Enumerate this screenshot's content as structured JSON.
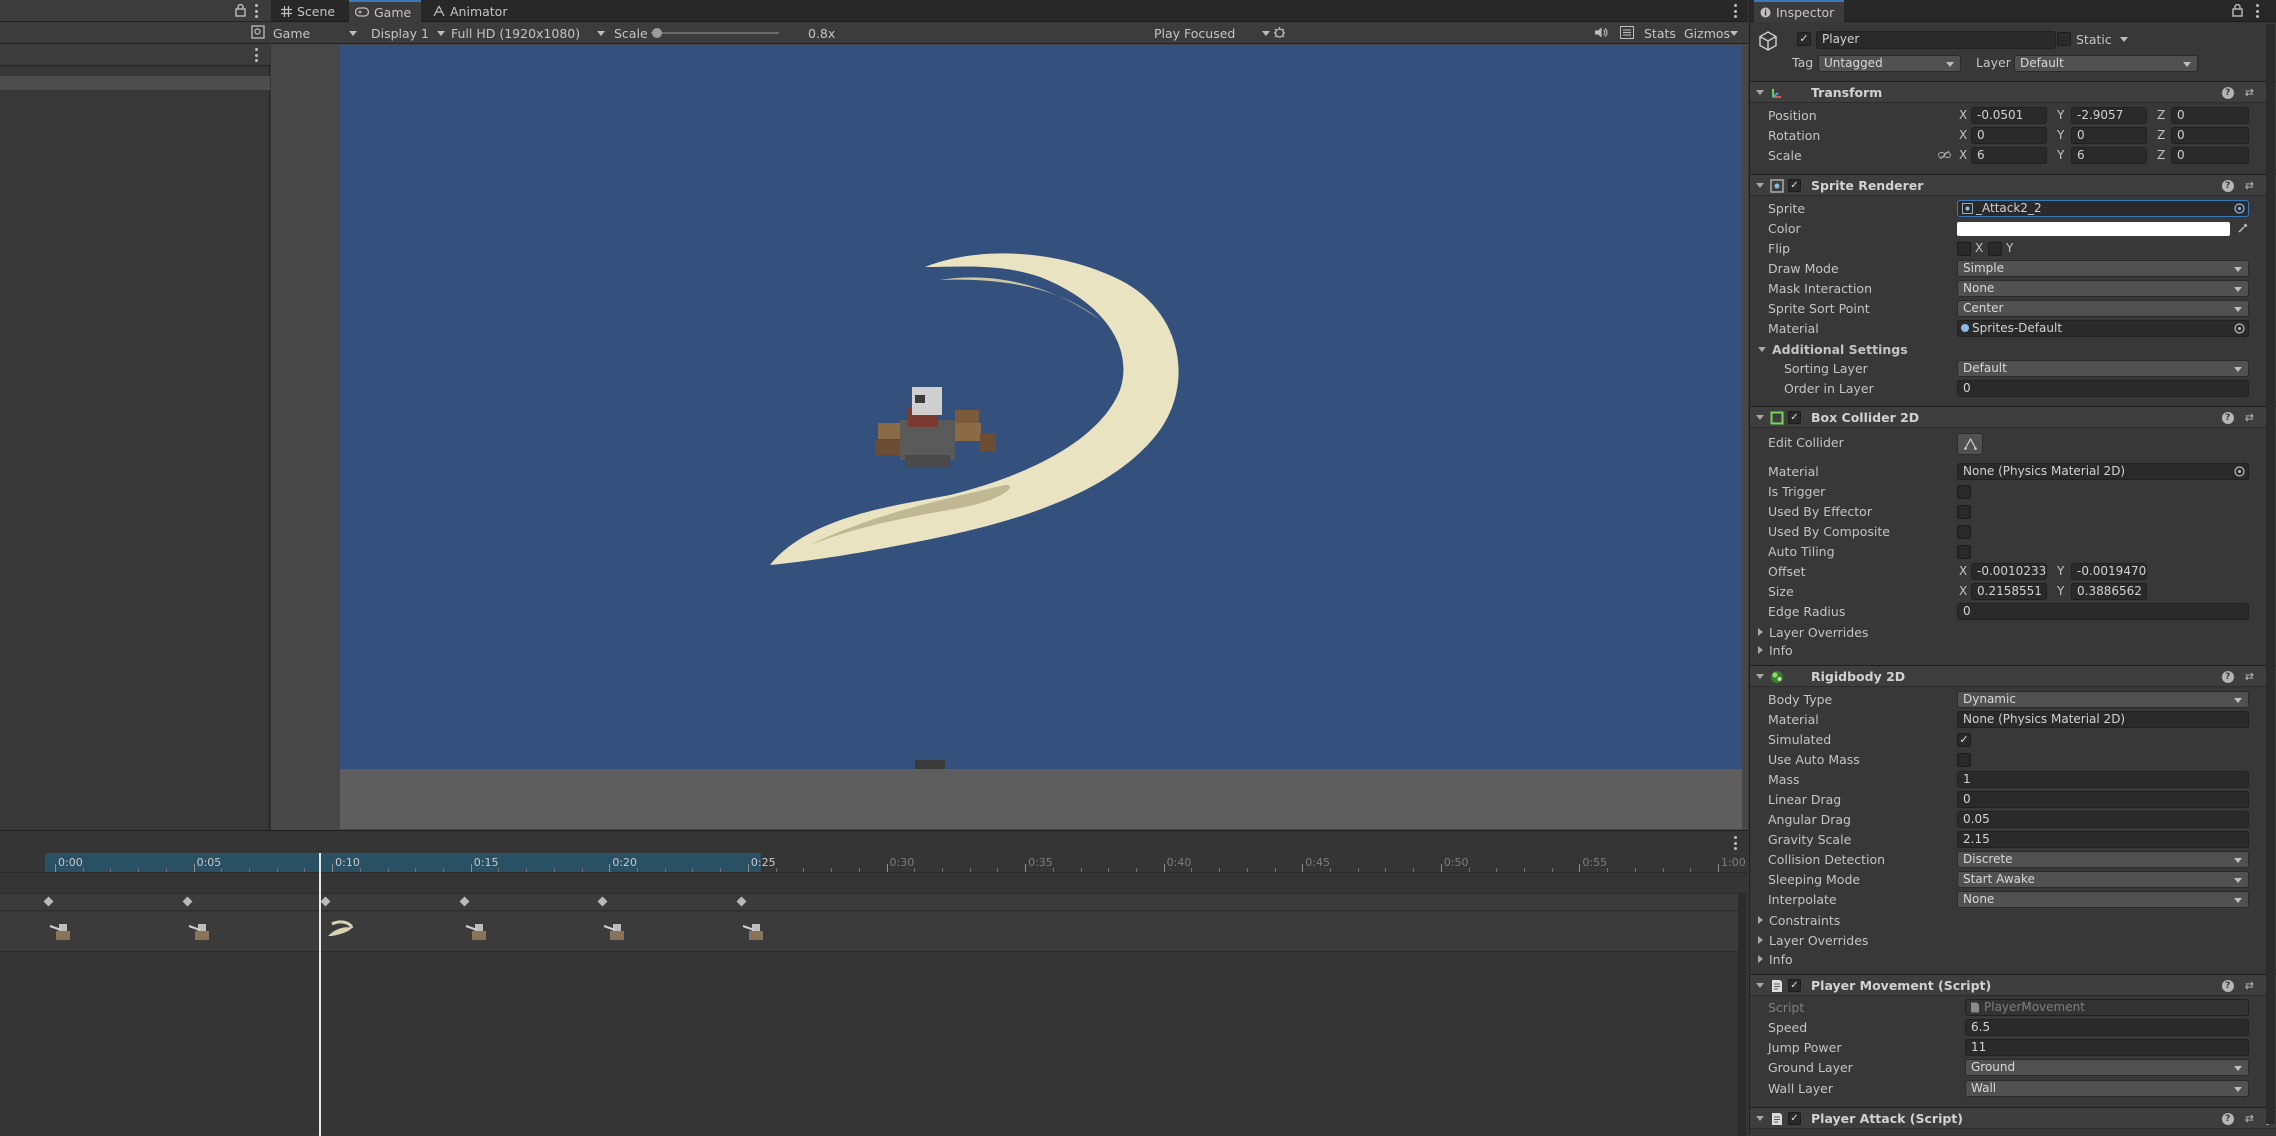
{
  "game_tabs": [
    {
      "label": "Scene",
      "icon": "grid-icon"
    },
    {
      "label": "Game",
      "icon": "gamepad-icon",
      "active": true
    },
    {
      "label": "Animator",
      "icon": "animator-icon"
    }
  ],
  "game_toolbar": {
    "mode": "Game",
    "display": "Display 1",
    "resolution": "Full HD (1920x1080)",
    "scale_label": "Scale",
    "scale_value": "0.8x",
    "scale_fraction": 0.05,
    "play_mode": "Play Focused",
    "stats": "Stats",
    "gizmos": "Gizmos"
  },
  "colors": {
    "sky": "#34507c",
    "ground": "#5e5e5e",
    "accent": "#3a79bb",
    "timeline_highlight": "#2a5064"
  },
  "inspector": {
    "tab": "Inspector",
    "object_name": "Player",
    "static_label": "Static",
    "tag_label": "Tag",
    "tag_value": "Untagged",
    "layer_label": "Layer",
    "layer_value": "Default",
    "transform": {
      "title": "Transform",
      "position_label": "Position",
      "rotation_label": "Rotation",
      "scale_label": "Scale",
      "position": {
        "x": "-0.0501",
        "y": "-2.9057",
        "z": "0"
      },
      "rotation": {
        "x": "0",
        "y": "0",
        "z": "0"
      },
      "scale": {
        "x": "6",
        "y": "6",
        "z": "0"
      }
    },
    "sprite_renderer": {
      "title": "Sprite Renderer",
      "rows": [
        {
          "label": "Sprite",
          "value": "_Attack2_2"
        },
        {
          "label": "Color",
          "value": ""
        },
        {
          "label": "Flip",
          "value": ""
        },
        {
          "label": "Draw Mode",
          "value": "Simple"
        },
        {
          "label": "Mask Interaction",
          "value": "None"
        },
        {
          "label": "Sprite Sort Point",
          "value": "Center"
        },
        {
          "label": "Material",
          "value": "Sprites-Default"
        }
      ],
      "flip_x": "X",
      "flip_y": "Y",
      "additional_settings": "Additional Settings",
      "sorting_layer_label": "Sorting Layer",
      "sorting_layer_value": "Default",
      "order_label": "Order in Layer",
      "order_value": "0"
    },
    "box_collider": {
      "title": "Box Collider 2D",
      "edit_collider": "Edit Collider",
      "material_label": "Material",
      "material_value": "None (Physics Material 2D)",
      "is_trigger": "Is Trigger",
      "used_by_effector": "Used By Effector",
      "used_by_composite": "Used By Composite",
      "auto_tiling": "Auto Tiling",
      "offset_label": "Offset",
      "offset_x": "-0.00102337",
      "offset_y": "-0.00194706",
      "size_label": "Size",
      "size_x": "0.2158551",
      "size_y": "0.3886562",
      "edge_radius_label": "Edge Radius",
      "edge_radius_value": "0",
      "layer_overrides": "Layer Overrides",
      "info": "Info"
    },
    "rigidbody": {
      "title": "Rigidbody 2D",
      "rows": [
        {
          "label": "Body Type",
          "value": "Dynamic",
          "kind": "drop"
        },
        {
          "label": "Material",
          "value": "None (Physics Material 2D)",
          "kind": "obj"
        },
        {
          "label": "Simulated",
          "value": "✓",
          "kind": "chk"
        },
        {
          "label": "Use Auto Mass",
          "value": "",
          "kind": "chk"
        },
        {
          "label": "Mass",
          "value": "1",
          "kind": "field"
        },
        {
          "label": "Linear Drag",
          "value": "0",
          "kind": "field"
        },
        {
          "label": "Angular Drag",
          "value": "0.05",
          "kind": "field"
        },
        {
          "label": "Gravity Scale",
          "value": "2.15",
          "kind": "field"
        },
        {
          "label": "Collision Detection",
          "value": "Discrete",
          "kind": "drop"
        },
        {
          "label": "Sleeping Mode",
          "value": "Start Awake",
          "kind": "drop"
        },
        {
          "label": "Interpolate",
          "value": "None",
          "kind": "drop"
        }
      ],
      "constraints": "Constraints",
      "layer_overrides": "Layer Overrides",
      "info": "Info"
    },
    "player_movement": {
      "title": "Player Movement (Script)",
      "script_label": "Script",
      "script_value": "PlayerMovement",
      "speed_label": "Speed",
      "speed_value": "6.5",
      "jump_label": "Jump Power",
      "jump_value": "11",
      "ground_label": "Ground Layer",
      "ground_value": "Ground",
      "wall_label": "Wall Layer",
      "wall_value": "Wall"
    },
    "player_attack": {
      "title": "Player Attack (Script)"
    }
  },
  "animation": {
    "time_labels": [
      "0:00",
      "0:05",
      "0:10",
      "0:15",
      "0:20",
      "0:25",
      "0:30",
      "0:35",
      "0:40",
      "0:45",
      "0:50",
      "0:55",
      "1:00"
    ],
    "playhead_label": "0:10",
    "keyframes": [
      0,
      5,
      10,
      15,
      20,
      25
    ]
  }
}
